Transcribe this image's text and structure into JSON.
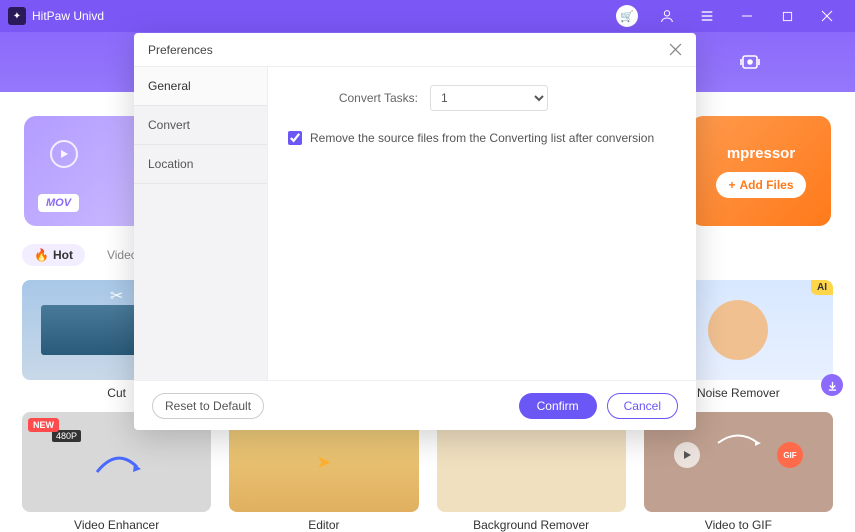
{
  "titlebar": {
    "app_name": "HitPaw Univd"
  },
  "topnav": {
    "tabs": [
      "home",
      "convert",
      "transfer",
      "record"
    ]
  },
  "left_card": {
    "badge": "MOV"
  },
  "right_card": {
    "title": "mpressor",
    "add_btn": "Add Files"
  },
  "filters": {
    "hot": "Hot",
    "video": "Video"
  },
  "tools_row1": [
    {
      "label": "Cut"
    },
    {
      "label": ""
    },
    {
      "label": ""
    },
    {
      "label": "Noise Remover"
    }
  ],
  "tools_row2": [
    {
      "label": "Video Enhancer",
      "badge": "480P"
    },
    {
      "label": "Editor"
    },
    {
      "label": "Background Remover"
    },
    {
      "label": "Video to GIF"
    }
  ],
  "modal": {
    "title": "Preferences",
    "side": {
      "general": "General",
      "convert": "Convert",
      "location": "Location"
    },
    "convert_tasks_label": "Convert Tasks:",
    "convert_tasks_value": "1",
    "remove_source_label": "Remove the source files from the Converting list after conversion",
    "remove_source_checked": true,
    "reset": "Reset to Default",
    "confirm": "Confirm",
    "cancel": "Cancel"
  }
}
